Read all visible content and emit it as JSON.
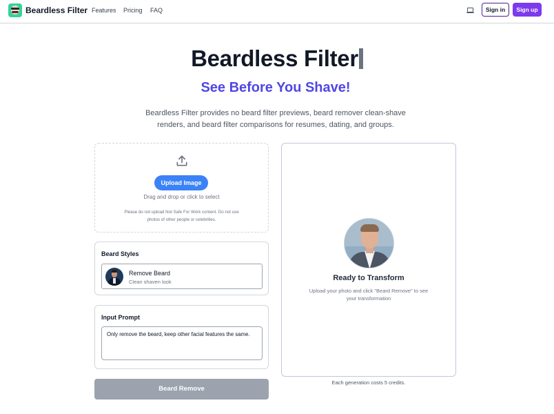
{
  "nav": {
    "brand": "Beardless Filter",
    "links": [
      "Features",
      "Pricing",
      "FAQ"
    ],
    "sign_in": "Sign in",
    "sign_up": "Sign up"
  },
  "hero": {
    "title": "Beardless Filter",
    "subtitle": "See Before You Shave!",
    "description": "Beardless Filter provides no beard filter previews, beard remover clean-shave renders, and beard filter comparisons for resumes, dating, and groups."
  },
  "upload": {
    "button": "Upload Image",
    "hint": "Drag and drop or click to select",
    "note": "Please do not upload Not Safe For Work content. Do not use photos of other people or celebrities."
  },
  "beard_styles": {
    "title": "Beard Styles",
    "selected": {
      "name": "Remove Beard",
      "description": "Clean shaven look"
    }
  },
  "prompt": {
    "title": "Input Prompt",
    "value": "Only remove the beard, keep other facial features the same."
  },
  "generate": {
    "label": "Beard Remove"
  },
  "preview": {
    "title": "Ready to Transform",
    "description": "Upload your photo and click \"Beard Remove\" to see your transformation",
    "credits_note": "Each generation costs 5 credits."
  },
  "colors": {
    "accent": "#7c3aed",
    "subtitle": "#4f46e5",
    "upload_button": "#3b82f6",
    "disabled_button": "#9ca3af"
  }
}
